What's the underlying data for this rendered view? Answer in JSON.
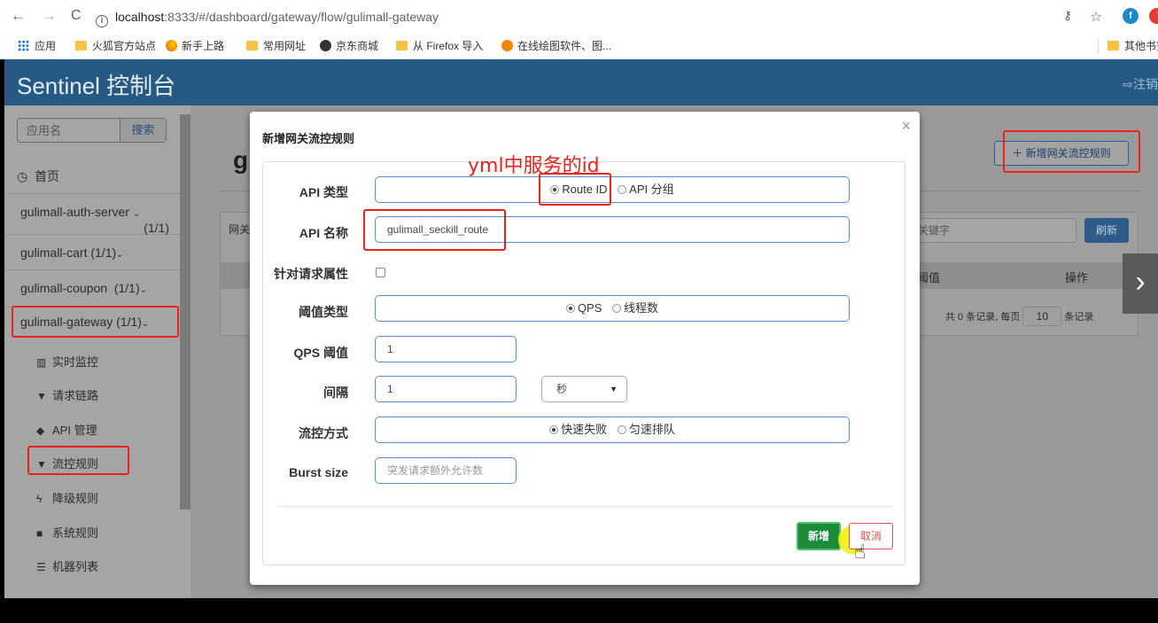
{
  "browser": {
    "url_host": "localhost",
    "url_rest": ":8333/#/dashboard/gateway/flow/gulimall-gateway",
    "ext_labels": [
      "f",
      "❗"
    ]
  },
  "bookmarks": [
    {
      "label": "应用",
      "icon": "apps-grid-icon"
    },
    {
      "label": "火狐官方站点",
      "icon": "folder-icon"
    },
    {
      "label": "新手上路",
      "icon": "firefox-icon"
    },
    {
      "label": "常用网址",
      "icon": "folder-icon"
    },
    {
      "label": "京东商城",
      "icon": "globe-icon"
    },
    {
      "label": "从 Firefox 导入",
      "icon": "folder-icon"
    },
    {
      "label": "在线绘图软件、图...",
      "icon": "drawio-icon"
    },
    {
      "label": "其他书签",
      "icon": "folder-icon"
    }
  ],
  "header": {
    "brand": "Sentinel 控制台",
    "logout": "注销"
  },
  "sidebar": {
    "search_placeholder": "应用名",
    "search_button": "搜索",
    "home": "首页",
    "apps": [
      {
        "name": "gulimall-auth-server",
        "count": "(1/1)"
      },
      {
        "name": "gulimall-cart",
        "count": "(1/1)"
      },
      {
        "name": "gulimall-coupon",
        "count": "(1/1)"
      },
      {
        "name": "gulimall-gateway",
        "count": "(1/1)"
      }
    ],
    "menu": [
      {
        "label": "实时监控",
        "icon": "bar-chart-icon"
      },
      {
        "label": "请求链路",
        "icon": "filter-icon"
      },
      {
        "label": "API 管理",
        "icon": "tag-icon"
      },
      {
        "label": "流控规则",
        "icon": "filter-icon"
      },
      {
        "label": "降级规则",
        "icon": "bolt-icon"
      },
      {
        "label": "系统规则",
        "icon": "lock-icon"
      },
      {
        "label": "机器列表",
        "icon": "list-icon"
      }
    ]
  },
  "content": {
    "title_initial": "g",
    "add_rule_button": "新增网关流控规则",
    "gateway_label": "网关",
    "keyword_placeholder": "关键字",
    "refresh_button": "刷新",
    "col_threshold": "阈值",
    "col_ops": "操作",
    "pager_prefix": "共 0 条记录, 每页",
    "page_size": "10",
    "pager_suffix": "条记录"
  },
  "modal": {
    "title": "新增网关流控规则",
    "close": "×",
    "annotation": "yml中服务的id",
    "api_type_label": "API 类型",
    "api_type_options": [
      "Route ID",
      "API 分组"
    ],
    "api_type_selected": "Route ID",
    "api_name_label": "API 名称",
    "api_name_value": "gulimall_seckill_route",
    "request_attr_label": "针对请求属性",
    "threshold_type_label": "阈值类型",
    "threshold_type_options": [
      "QPS",
      "线程数"
    ],
    "threshold_type_selected": "QPS",
    "qps_label": "QPS 阈值",
    "qps_value": "1",
    "interval_label": "间隔",
    "interval_value": "1",
    "interval_unit": "秒",
    "control_label": "流控方式",
    "control_options": [
      "快速失败",
      "匀速排队"
    ],
    "control_selected": "快速失败",
    "burst_label": "Burst size",
    "burst_placeholder": "突发请求额外允许数",
    "add_button": "新增",
    "cancel_button": "取消"
  },
  "colors": {
    "header_bg": "#265a85",
    "highlight_red": "#e8231c",
    "primary_blue": "#5b8ed6",
    "success_green": "#1c8b3a",
    "danger_red": "#d9534f"
  }
}
